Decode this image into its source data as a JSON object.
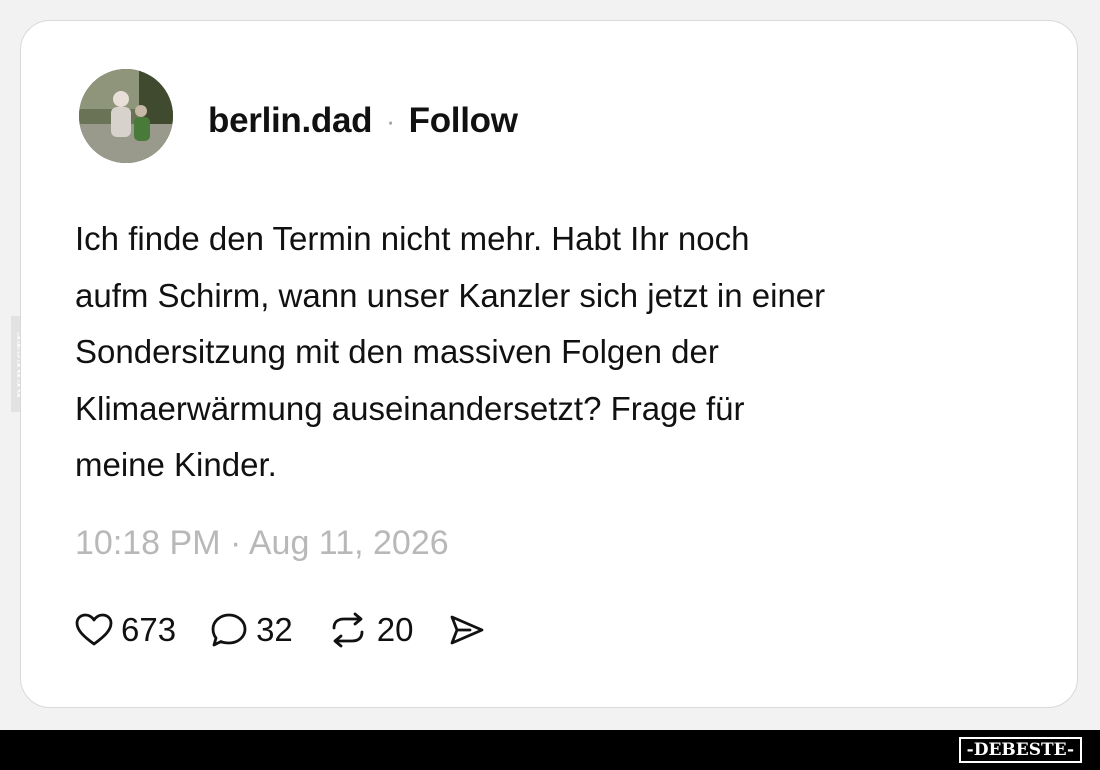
{
  "post": {
    "username": "berlin.dad",
    "separator": "·",
    "follow_label": "Follow",
    "text_lines": [
      "Ich finde den Termin nicht mehr. Habt Ihr noch",
      "aufm Schirm, wann unser Kanzler sich jetzt in einer",
      "Sondersitzung mit den massiven Folgen der",
      "Klimaerwärmung auseinandersetzt? Frage für",
      "meine Kinder."
    ],
    "timestamp": "10:18 PM · Aug 11, 2026",
    "likes": "673",
    "replies": "32",
    "reposts": "20"
  },
  "watermark": {
    "side_text": "DEBESTE",
    "brand_text": "-DEBESTE-"
  },
  "icons": {
    "like": "heart-icon",
    "reply": "speech-bubble-icon",
    "repost": "repost-icon",
    "share": "send-icon"
  }
}
